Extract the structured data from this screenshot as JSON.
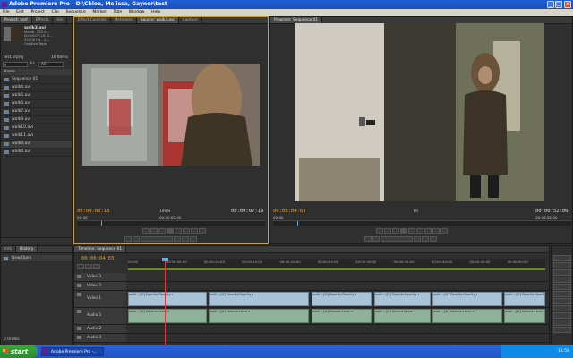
{
  "window": {
    "title": "Adobe Premiere Pro - D:\\Chloe, Melissa, Gaynor\\test",
    "minimize": "_",
    "maximize": "□",
    "close": "x"
  },
  "menu": [
    "File",
    "Edit",
    "Project",
    "Clip",
    "Sequence",
    "Marker",
    "Title",
    "Window",
    "Help"
  ],
  "project_panel": {
    "tabs": [
      "Project: test",
      "Effects",
      "His"
    ],
    "preview": {
      "name": "walk3.avi",
      "line1": "Movie, 720 x ...",
      "line2": "00:00:07:19, 2...",
      "line3": "32000 Hz - 1...",
      "line4": "Untitled Tape"
    },
    "project_file": "test.prproj",
    "item_count": "10 Items",
    "in_label": "In:",
    "in_value": "All",
    "column_header": "Name",
    "items": [
      "Sequence 01",
      "walk4.avi",
      "walk5.avi",
      "walk6.avi",
      "walk7.avi",
      "walk9.avi",
      "walk10.avi",
      "walk11.avi",
      "walk3.avi",
      "walk4.avi"
    ],
    "selected_index": 8
  },
  "source_panel": {
    "tabs": [
      "Effect Controls",
      "Metadata",
      "Source: walk3.avi",
      "Capture"
    ],
    "timecode_in": "00:00:00:18",
    "zoom": "100%",
    "timecode_dur": "00:00:07:19",
    "ruler_start": "00:00",
    "ruler_mid": "00:00:05:00"
  },
  "program_panel": {
    "tabs": [
      "Program: Sequence 01"
    ],
    "timecode_in": "00:00:04:03",
    "zoom": "Fit",
    "timecode_dur": "00:00:52:00",
    "ruler_start": "00:00",
    "ruler_end": "00:00:52:00"
  },
  "info_panel": {
    "tabs": [
      "Info",
      "History"
    ],
    "items": [
      "New/Open"
    ],
    "undo": "0 Undos"
  },
  "timeline": {
    "tab": "Timeline: Sequence 01",
    "timecode": "00:00:04:03",
    "ruler_labels": [
      "00:00",
      "00:00:05:00",
      "00:00:10:00",
      "00:00:15:00",
      "00:00:20:00",
      "00:00:25:00",
      "00:00:30:00",
      "00:00:35:00",
      "00:00:40:00",
      "00:00:45:00",
      "00:00:50:00"
    ],
    "tracks": [
      "Video 3",
      "Video 2",
      "Video 1",
      "Audio 1",
      "Audio 2",
      "Audio 3"
    ],
    "video_clip_label": "walk ...[V]  Opacity:Opacity ▾",
    "audio_clip_label": "walk ...[A]  Volume:Level ▾"
  },
  "taskbar": {
    "start": "start",
    "task": "Adobe Premiere Pro -...",
    "clock": "11:59"
  }
}
